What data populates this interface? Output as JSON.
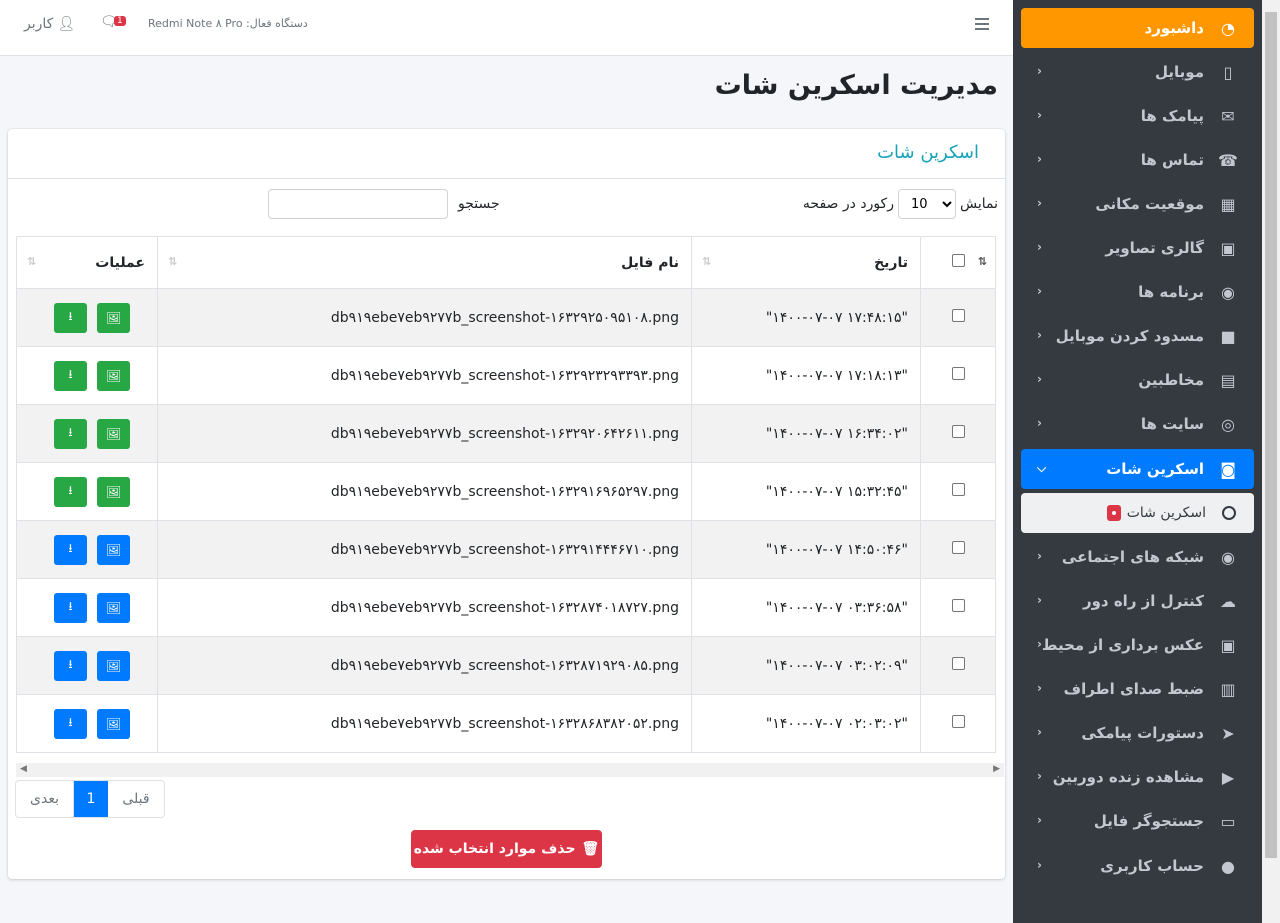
{
  "navbar": {
    "user_label": "کاربر",
    "msg_badge": "1",
    "device_label": "دستگاه فعال: Redmi Note ۸ Pro"
  },
  "page_title": "مدیریت اسکرین شات",
  "card_title": "اسکرین شات",
  "controls": {
    "show_label": "نمایش",
    "per_page_value": "10",
    "per_page_suffix": "رکورد در صفحه",
    "search_label": "جستجو",
    "search_value": ""
  },
  "table": {
    "headers": {
      "date": "تاریخ",
      "filename": "نام فایل",
      "ops": "عملیات"
    },
    "rows": [
      {
        "date": "\"۱۴۰۰-۰۷-۰۷ ۱۷:۴۸:۱۵\"",
        "filename": "db۹۱۹ebe۷eb۹۲۷۷b_screenshot-۱۶۳۲۹۲۵۰۹۵۱۰۸.png"
      },
      {
        "date": "\"۱۴۰۰-۰۷-۰۷ ۱۷:۱۸:۱۳\"",
        "filename": "db۹۱۹ebe۷eb۹۲۷۷b_screenshot-۱۶۳۲۹۲۳۲۹۳۳۹۳.png"
      },
      {
        "date": "\"۱۴۰۰-۰۷-۰۷ ۱۶:۳۴:۰۲\"",
        "filename": "db۹۱۹ebe۷eb۹۲۷۷b_screenshot-۱۶۳۲۹۲۰۶۴۲۶۱۱.png"
      },
      {
        "date": "\"۱۴۰۰-۰۷-۰۷ ۱۵:۳۲:۴۵\"",
        "filename": "db۹۱۹ebe۷eb۹۲۷۷b_screenshot-۱۶۳۲۹۱۶۹۶۵۲۹۷.png"
      },
      {
        "date": "\"۱۴۰۰-۰۷-۰۷ ۱۴:۵۰:۴۶\"",
        "filename": "db۹۱۹ebe۷eb۹۲۷۷b_screenshot-۱۶۳۲۹۱۴۴۴۶۷۱۰.png"
      },
      {
        "date": "\"۱۴۰۰-۰۷-۰۷ ۰۳:۳۶:۵۸\"",
        "filename": "db۹۱۹ebe۷eb۹۲۷۷b_screenshot-۱۶۳۲۸۷۴۰۱۸۷۲۷.png"
      },
      {
        "date": "\"۱۴۰۰-۰۷-۰۷ ۰۳:۰۲:۰۹\"",
        "filename": "db۹۱۹ebe۷eb۹۲۷۷b_screenshot-۱۶۳۲۸۷۱۹۲۹۰۸۵.png"
      },
      {
        "date": "\"۱۴۰۰-۰۷-۰۷ ۰۲:۰۳:۰۲\"",
        "filename": "db۹۱۹ebe۷eb۹۲۷۷b_screenshot-۱۶۳۲۸۶۸۳۸۲۰۵۲.png"
      }
    ]
  },
  "pager": {
    "next": "بعدی",
    "current": "1",
    "prev": "قبلی"
  },
  "delete_button": "حذف موارد انتخاب شده",
  "sidebar": {
    "items": [
      {
        "label": "داشبورد",
        "icon": "dashboard-icon"
      },
      {
        "label": "موبایل",
        "icon": "mobile-icon"
      },
      {
        "label": "پیامک ها",
        "icon": "envelope-icon"
      },
      {
        "label": "تماس ها",
        "icon": "phone-icon"
      },
      {
        "label": "موقعیت مکانی",
        "icon": "map-icon"
      },
      {
        "label": "گالری تصاویر",
        "icon": "image-icon"
      },
      {
        "label": "برنامه ها",
        "icon": "gamepad-icon"
      },
      {
        "label": "مسدود کردن موبایل",
        "icon": "lock-icon"
      },
      {
        "label": "مخاطبین",
        "icon": "address-book-icon"
      },
      {
        "label": "سایت ها",
        "icon": "chrome-icon"
      },
      {
        "label": "اسکرین شات",
        "icon": "binoculars-icon"
      },
      {
        "label": "شبکه های اجتماعی",
        "icon": "eye-icon"
      },
      {
        "label": "کنترل از راه دور",
        "icon": "cloud-icon"
      },
      {
        "label": "عکس برداری از محیط",
        "icon": "camera-icon"
      },
      {
        "label": "ضبط صدای اطراف",
        "icon": "audio-file-icon"
      },
      {
        "label": "دستورات پیامکی",
        "icon": "paper-plane-icon"
      },
      {
        "label": "مشاهده زنده دوربین",
        "icon": "video-icon"
      },
      {
        "label": "جستجوگر فایل",
        "icon": "folder-icon"
      },
      {
        "label": "حساب کاربری",
        "icon": "user-icon"
      }
    ],
    "sub_item": "اسکرین شات",
    "colors": {
      "dashboard": "#ff9800",
      "active": "#007bff",
      "bg": "#343a40"
    }
  }
}
